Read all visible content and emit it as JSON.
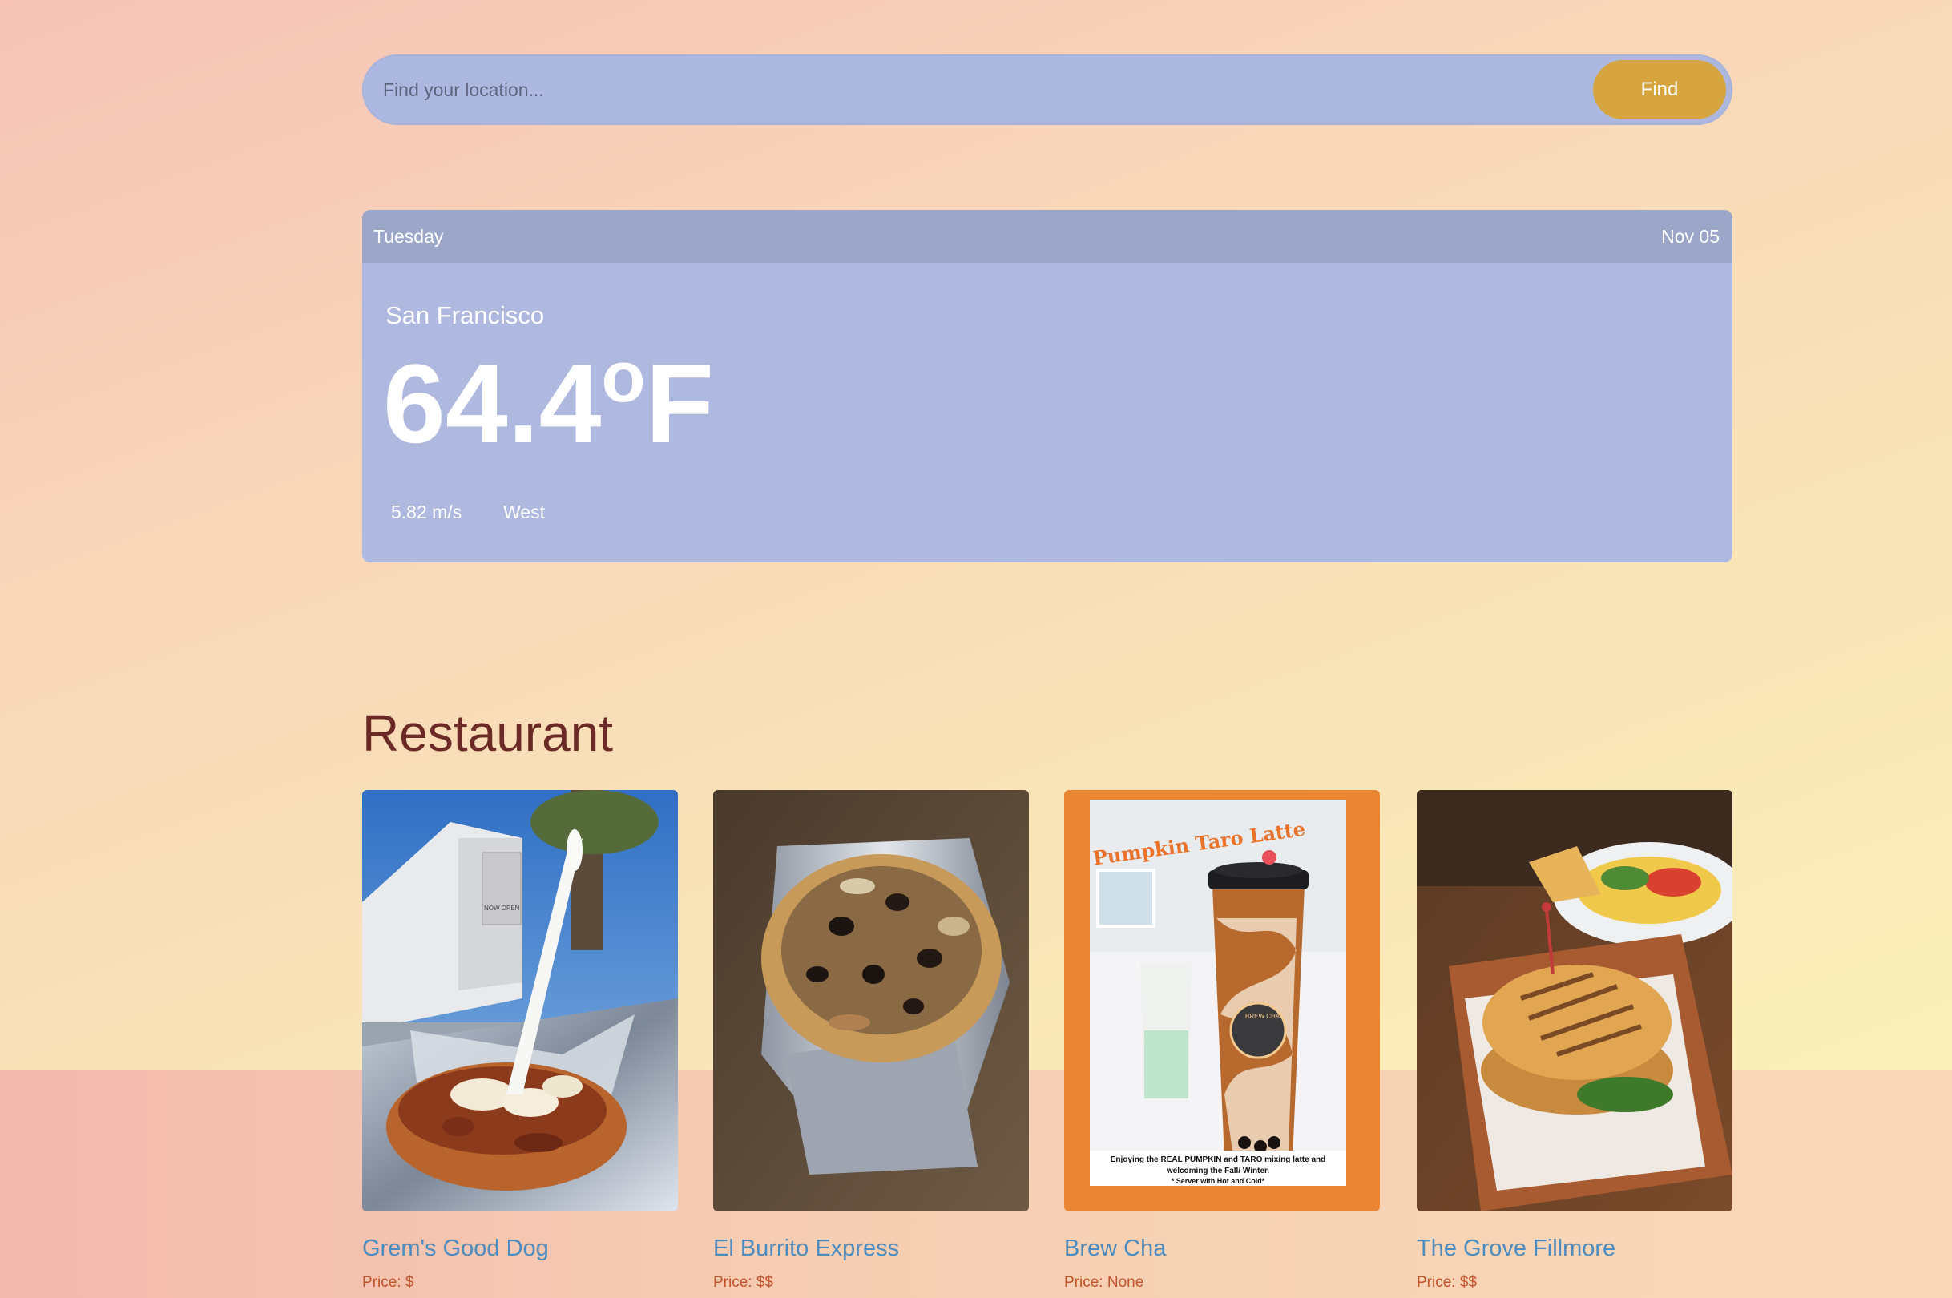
{
  "search": {
    "placeholder": "Find your location...",
    "button_label": "Find"
  },
  "weather": {
    "day": "Tuesday",
    "date": "Nov 05",
    "city": "San Francisco",
    "temperature": "64.4",
    "unit_degree": "o",
    "unit_letter": "F",
    "wind_speed": "5.82 m/s",
    "wind_direction": "West"
  },
  "restaurants": {
    "title": "Restaurant",
    "items": [
      {
        "name": "Grem's Good Dog",
        "price": "Price: $",
        "photo": "hot-dog-photo"
      },
      {
        "name": "El Burrito Express",
        "price": "Price: $$",
        "photo": "burrito-photo"
      },
      {
        "name": "Brew Cha",
        "price": "Price: None",
        "photo": "pumpkin-taro-latte-photo",
        "photo_text": {
          "headline": "Pumpkin Taro Latte",
          "caption_line1": "Enjoying the REAL PUMPKIN and TARO mixing latte and",
          "caption_line2": "welcoming the Fall/ Winter.",
          "caption_line3": "* Server with Hot and Cold*",
          "cup_brand": "BREW CHA",
          "sign_text": "NOW OPEN"
        }
      },
      {
        "name": "The Grove Fillmore",
        "price": "Price: $$",
        "photo": "burger-photo"
      }
    ]
  },
  "colors": {
    "search_bg": "#adb8e0",
    "find_button": "#d6a53f",
    "weather_card": "#afb8df",
    "weather_header": "#9ca6c8",
    "section_title": "#6b2a26",
    "restaurant_name": "#4b8bbf",
    "price_text": "#c4522a"
  }
}
